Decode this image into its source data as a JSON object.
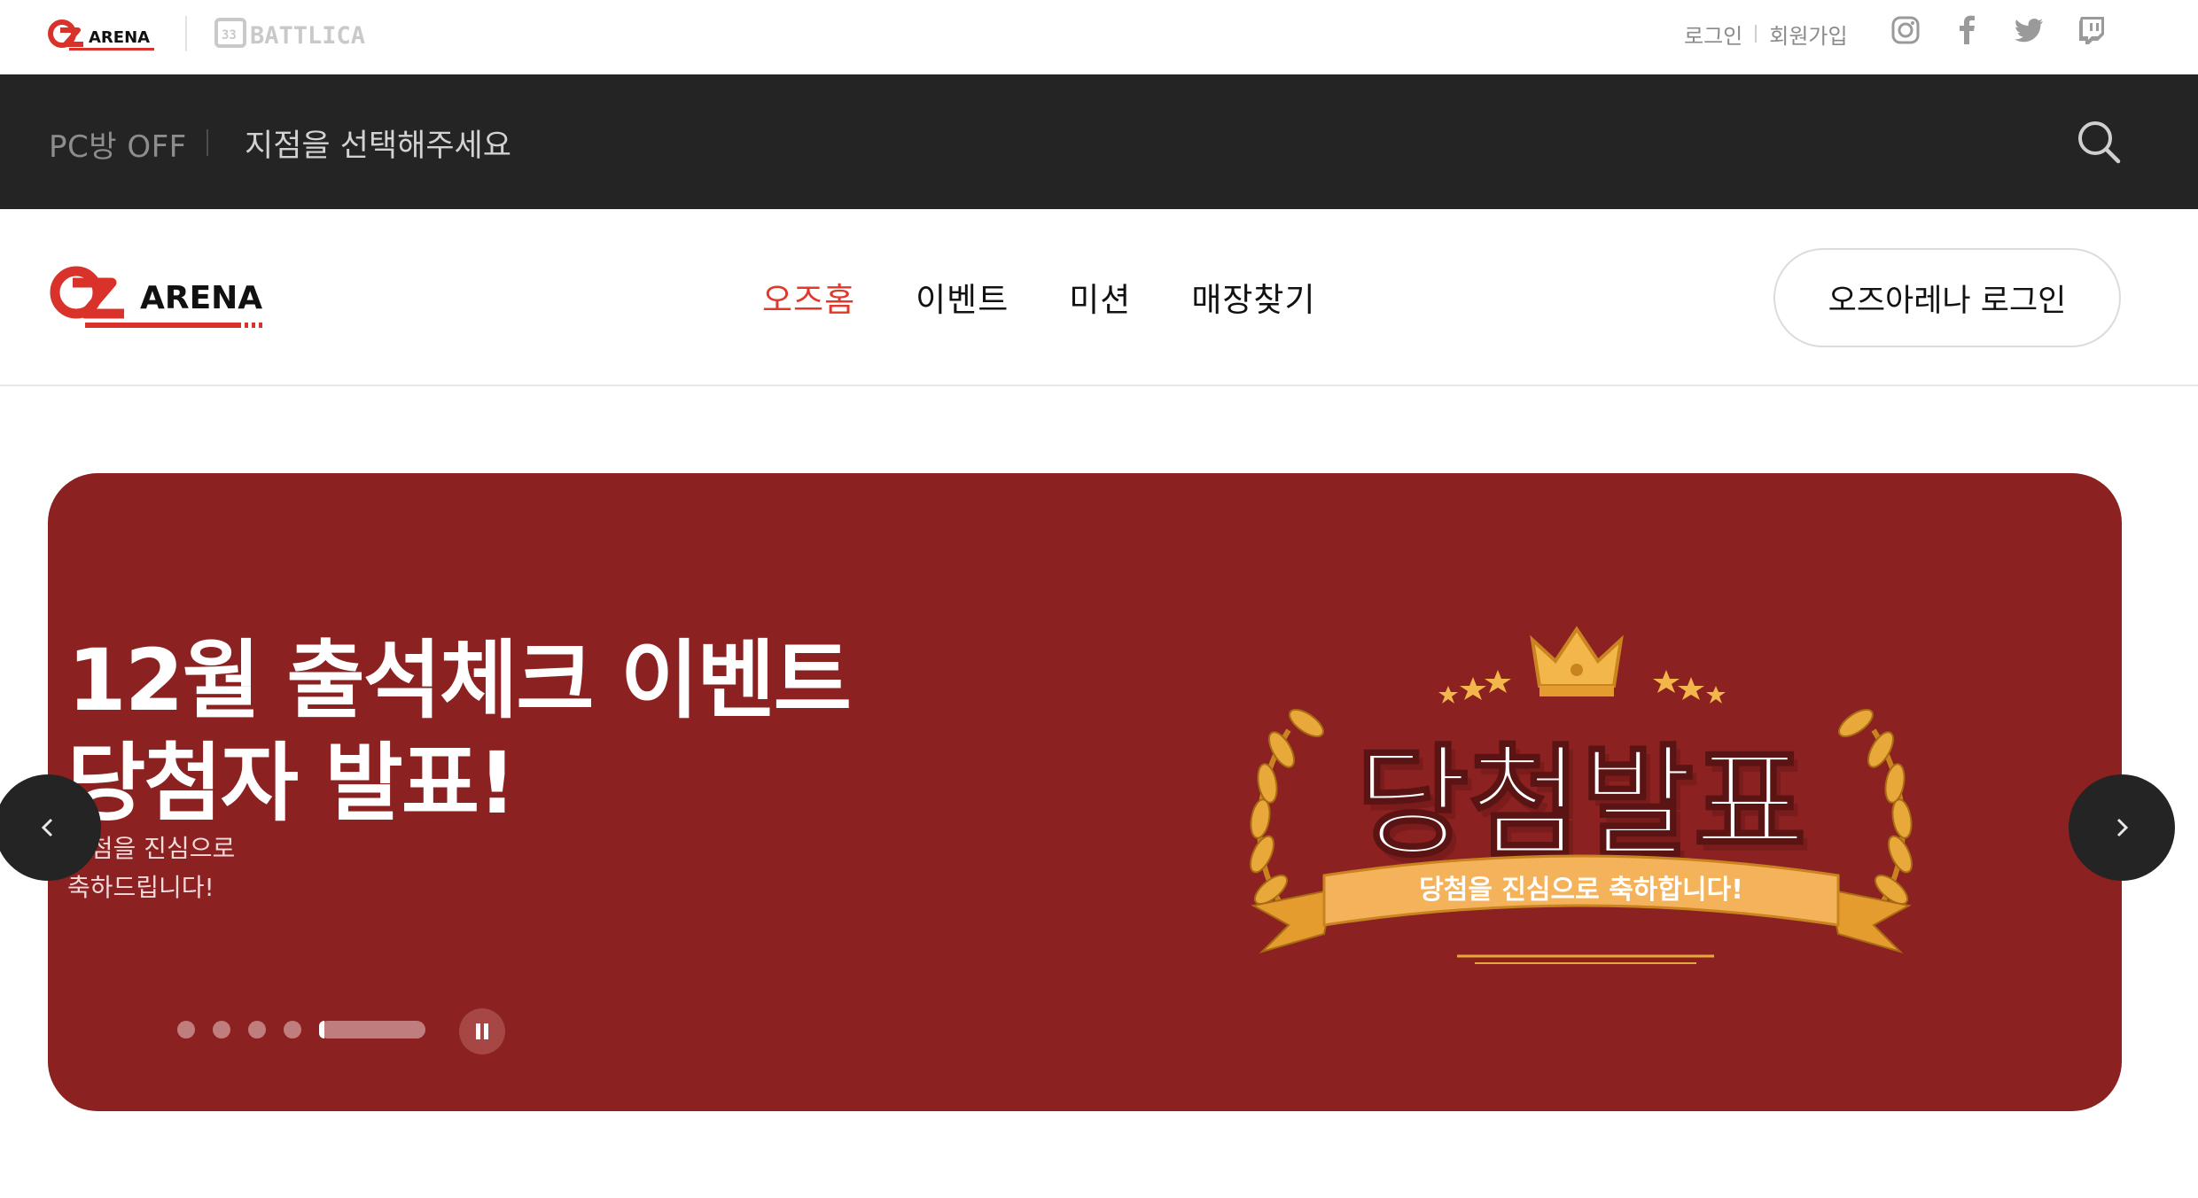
{
  "utility": {
    "login": "로그인",
    "signup": "회원가입",
    "social": [
      "instagram-icon",
      "facebook-icon",
      "twitter-icon",
      "twitch-icon"
    ]
  },
  "brands": {
    "oz_logo_text": "ARENA",
    "battlica_logo_text": "BATTLICA"
  },
  "store_bar": {
    "pc_status": "PC방 OFF",
    "store_select": "지점을 선택해주세요"
  },
  "nav": {
    "items": [
      "오즈홈",
      "이벤트",
      "미션",
      "매장찾기"
    ],
    "active": "오즈홈",
    "login_button": "오즈아레나 로그인"
  },
  "hero": {
    "title_line1": "12월 출석체크 이벤트",
    "title_line2": "당첨자 발표!",
    "sub_line1": "당첨을 진심으로",
    "sub_line2": "축하드립니다!",
    "art_title": "당첨발표",
    "art_ribbon": "당첨을 진심으로 축하합니다!",
    "slide_count": 5,
    "current_slide": 5,
    "slide_progress": 0.05,
    "background": "#8b2120"
  },
  "colors": {
    "accent": "#e0392b",
    "dark_bar": "#242424"
  }
}
